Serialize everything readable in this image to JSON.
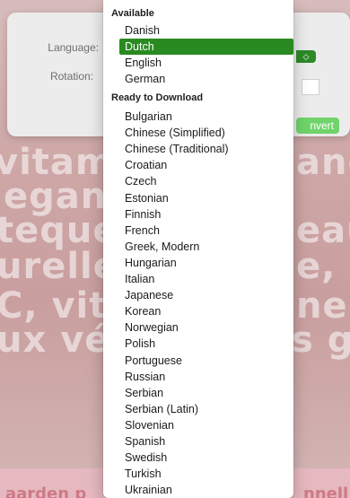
{
  "dialog": {
    "language_label": "Language:",
    "rotation_label": "Rotation:",
    "convert_label": "nvert",
    "select_chevron": "◇"
  },
  "background": {
    "words": [
      "vitamin",
      "and",
      "egans.",
      "teque.",
      "eau",
      "urelle:",
      "e, g",
      "C, vita",
      "ne",
      "ux vég",
      "s glu"
    ],
    "bottom_left": "aarden p",
    "bottom_right": "nnell"
  },
  "menu": {
    "available_header": "Available",
    "available": [
      "Danish",
      "Dutch",
      "English",
      "German"
    ],
    "selected": "Dutch",
    "download_header": "Ready to Download",
    "download": [
      "Bulgarian",
      "Chinese (Simplified)",
      "Chinese (Traditional)",
      "Croatian",
      "Czech",
      "Estonian",
      "Finnish",
      "French",
      "Greek, Modern",
      "Hungarian",
      "Italian",
      "Japanese",
      "Korean",
      "Norwegian",
      "Polish",
      "Portuguese",
      "Russian",
      "Serbian",
      "Serbian (Latin)",
      "Slovenian",
      "Spanish",
      "Swedish",
      "Turkish",
      "Ukrainian"
    ]
  },
  "colors": {
    "selection": "#2a8a22",
    "convert_button": "#70d46a"
  }
}
